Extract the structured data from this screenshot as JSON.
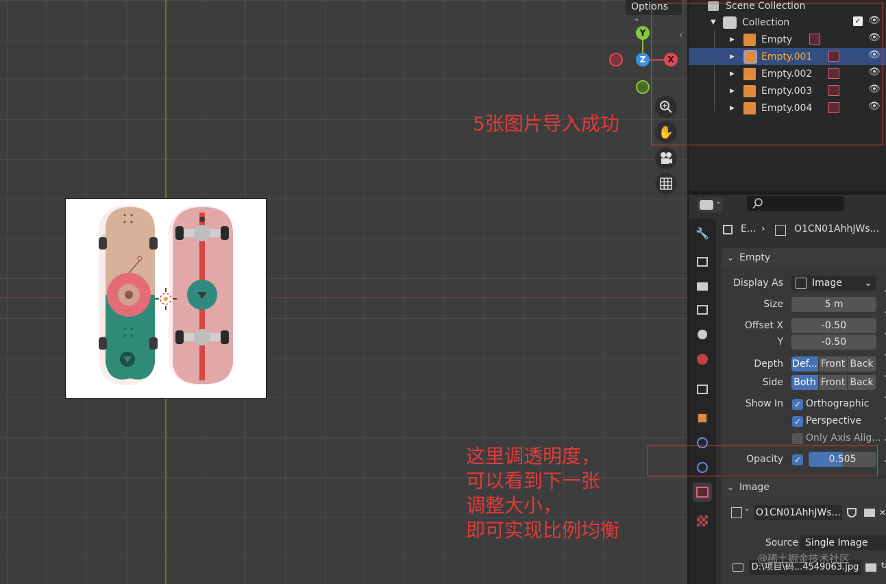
{
  "viewport": {
    "options_label": "Options",
    "gizmo": {
      "y": "Y",
      "z": "Z",
      "x": "X"
    }
  },
  "outliner": {
    "header": "Scene Collection",
    "collection": "Collection",
    "items": [
      {
        "label": "Empty"
      },
      {
        "label": "Empty.001"
      },
      {
        "label": "Empty.002"
      },
      {
        "label": "Empty.003"
      },
      {
        "label": "Empty.004"
      }
    ]
  },
  "properties": {
    "breadcrumb_obj": "E...",
    "breadcrumb_data": "O1CN01AhhJWs...",
    "empty_panel": "Empty",
    "display_as_label": "Display As",
    "display_as_value": "Image",
    "size_label": "Size",
    "size_value": "5 m",
    "offset_x_label": "Offset X",
    "offset_x_value": "-0.50",
    "offset_y_label": "Y",
    "offset_y_value": "-0.50",
    "depth_label": "Depth",
    "depth_options": [
      "Def...",
      "Front",
      "Back"
    ],
    "side_label": "Side",
    "side_options": [
      "Both",
      "Front",
      "Back"
    ],
    "show_in_label": "Show In",
    "show_orthographic": "Orthographic",
    "show_perspective": "Perspective",
    "show_only_axis": "Only Axis Alig...",
    "opacity_label": "Opacity",
    "opacity_value": "0.505",
    "opacity_fraction": 0.505,
    "image_panel": "Image",
    "image_name": "O1CN01AhhJWs...",
    "source_label": "Source",
    "source_value": "Single Image",
    "filepath": "D:\\项目\\码...4549063.jpg"
  },
  "annotations": {
    "top": "5张图片导入成功",
    "bottom_lines": [
      "这里调透明度，",
      "可以看到下一张",
      "调整大小，",
      "即可实现比例均衡"
    ]
  },
  "watermark": "@稀土掘金技术社区",
  "colors": {
    "accent_blue": "#4772b3",
    "selected_row": "#334d80",
    "selected_text": "#ffaf29",
    "annotation_red": "#e23b3b",
    "axis_x": "#e0475a",
    "axis_y": "#8ac43a",
    "axis_z": "#3f8fe0"
  }
}
